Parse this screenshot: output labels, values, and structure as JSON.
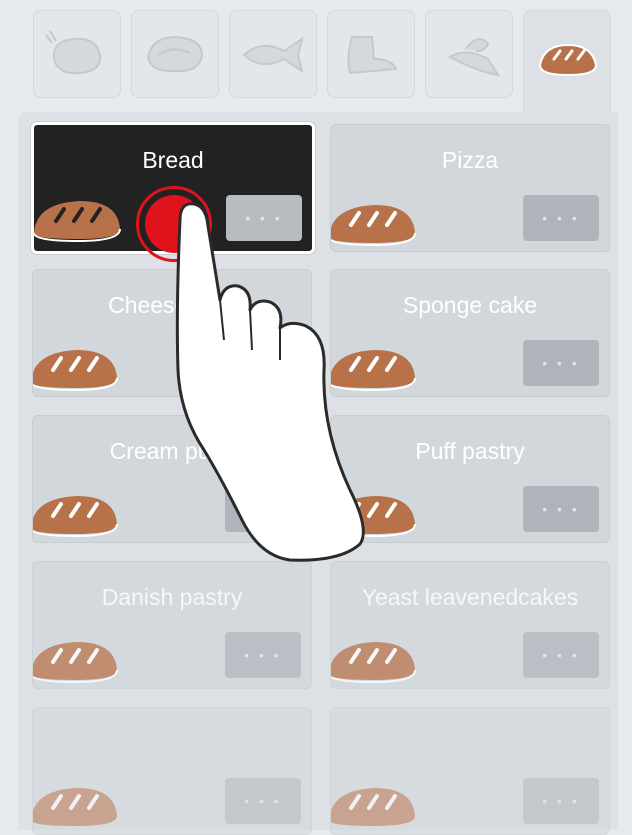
{
  "tabs": [
    {
      "name": "poultry-icon",
      "active": false
    },
    {
      "name": "meat-icon",
      "active": false
    },
    {
      "name": "fish-icon",
      "active": false
    },
    {
      "name": "side-dish-icon",
      "active": false
    },
    {
      "name": "vegetables-icon",
      "active": false
    },
    {
      "name": "bakery-icon",
      "active": true
    }
  ],
  "programs": [
    {
      "label": "Bread",
      "selected": true,
      "more": "• • •"
    },
    {
      "label": "Pizza",
      "more": "• • •"
    },
    {
      "label": "Cheesecake",
      "more": "• • •"
    },
    {
      "label": "Sponge cake",
      "more": "• • •"
    },
    {
      "label": "Cream puffs",
      "more": "• • •"
    },
    {
      "label": "Puff pastry",
      "more": "• • •"
    },
    {
      "label": "Danish pastry",
      "more": "• • •"
    },
    {
      "label": "Yeast leavenedcakes",
      "more": "• • •"
    },
    {
      "label": "",
      "more": "• • •"
    },
    {
      "label": "",
      "more": "• • •"
    }
  ],
  "colors": {
    "background": "#e6eaed",
    "selected_card": "#222222",
    "tap_indicator": "#e0131d",
    "bread_icon": "#b8724a"
  },
  "icons": {
    "bread": "bread-loaf-icon",
    "hand": "pointing-hand-icon"
  }
}
